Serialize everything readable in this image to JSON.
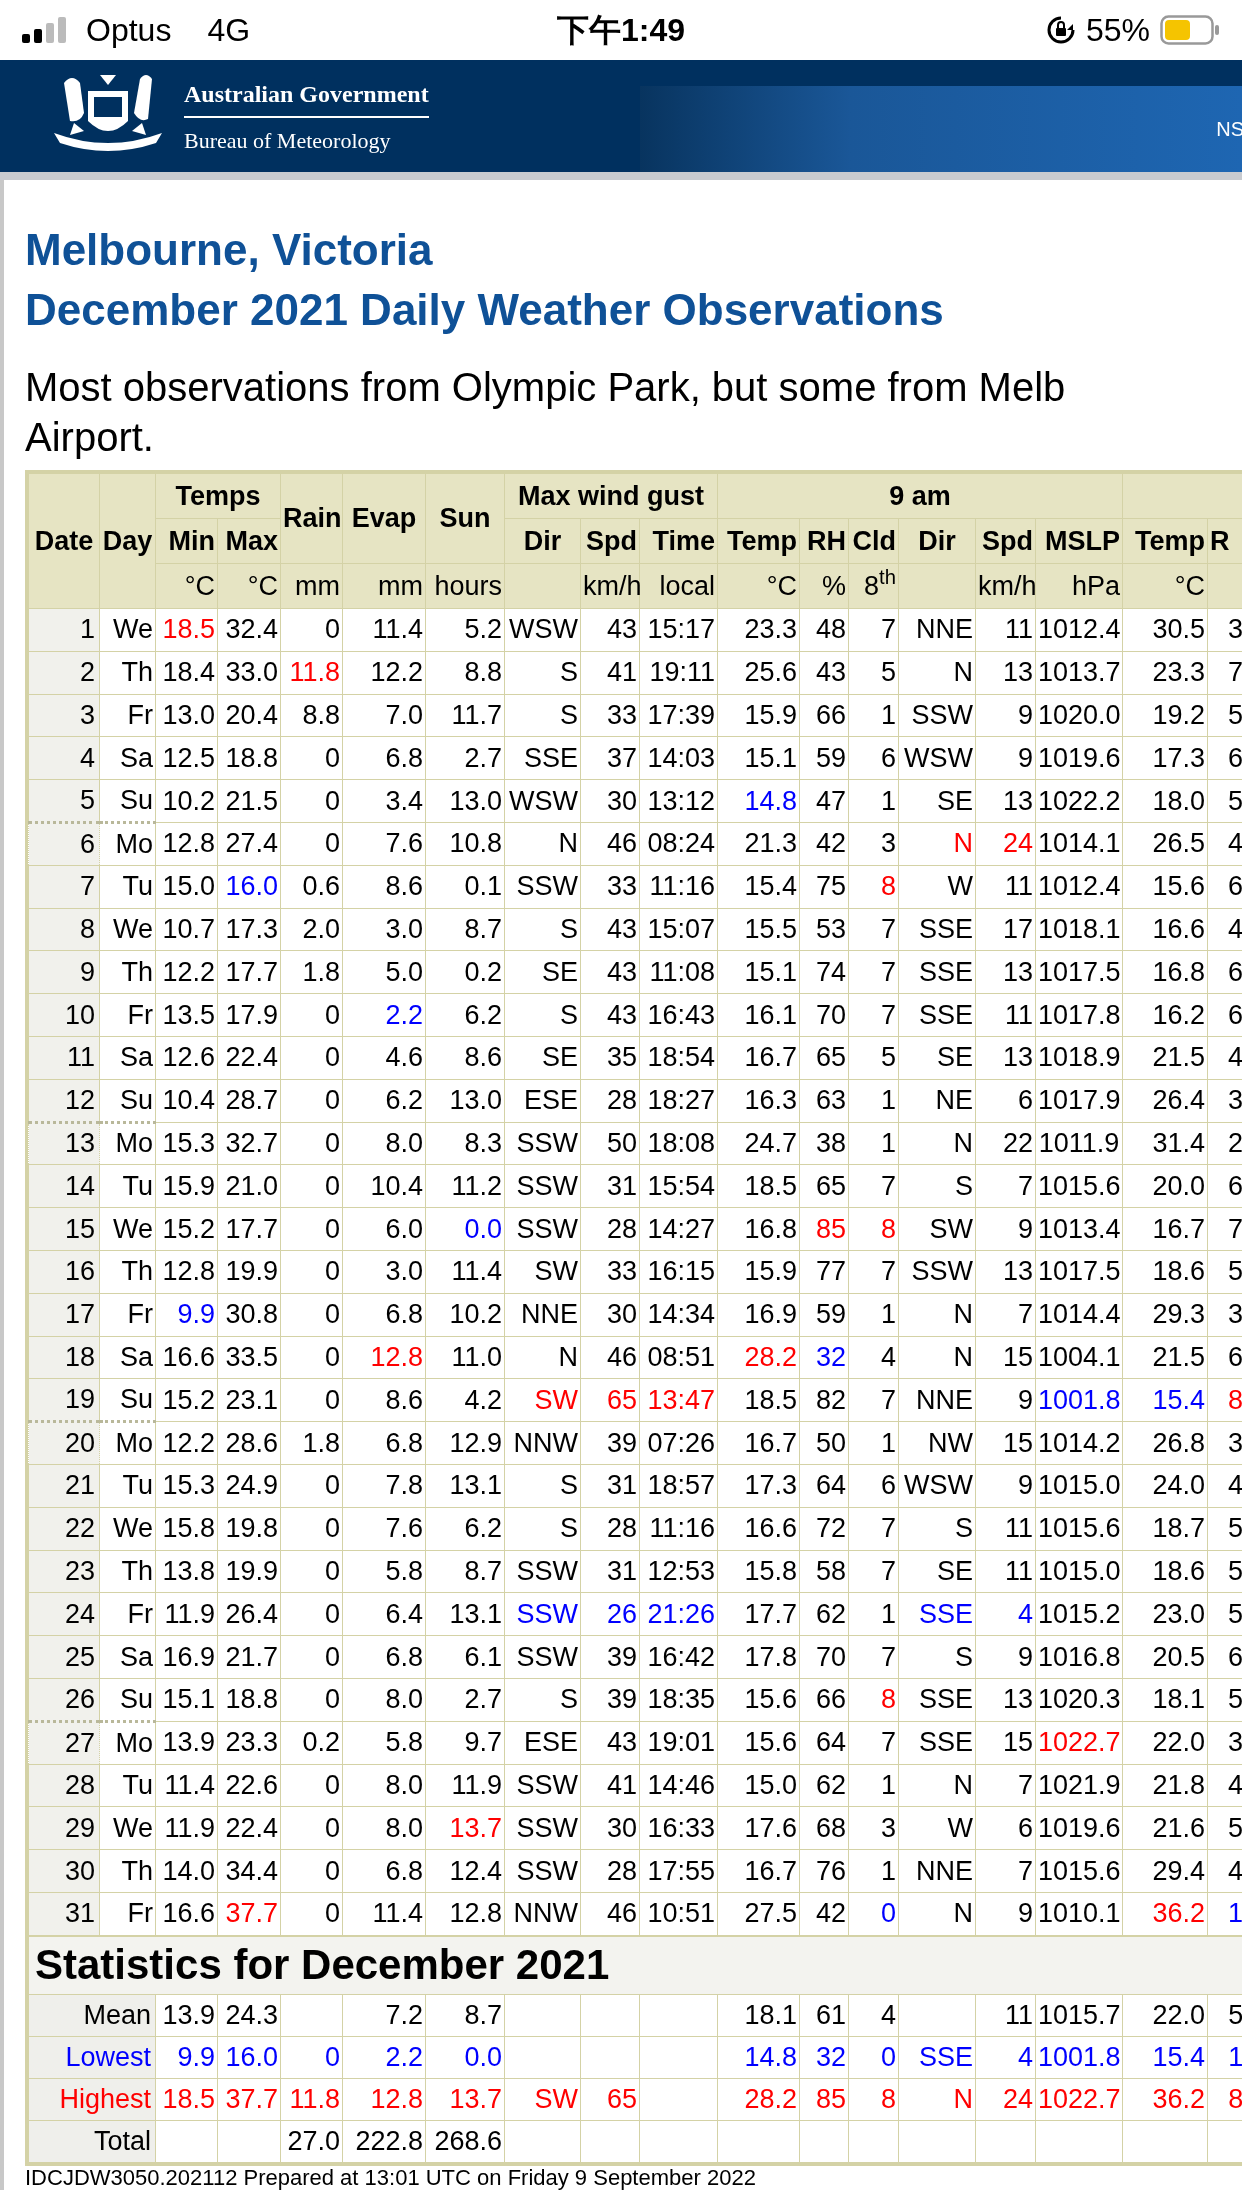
{
  "status_bar": {
    "carrier": "Optus",
    "network": "4G",
    "time": "下午1:49",
    "battery": "55%"
  },
  "banner": {
    "line_1": "Australian Government",
    "line_2": "Bureau of Meteorology",
    "nav_text": "NS"
  },
  "title_lines": [
    "Melbourne, Victoria",
    "December 2021 Daily Weather Observations"
  ],
  "subtitle_lines": [
    "Most observations from Olympic Park, but some from Melb",
    "Airport."
  ],
  "table": {
    "header": {
      "date": "Date",
      "day": "Day",
      "temps": "Temps",
      "rain": "Rain",
      "evap": "Evap",
      "sun": "Sun",
      "gust": "Max wind gust",
      "nine_am": "9 am",
      "columns": [
        "Min",
        "Max",
        "Dir",
        "Spd",
        "Time",
        "Temp",
        "RH",
        "Cld",
        "Dir",
        "Spd",
        "MSLP",
        "Temp",
        "R"
      ],
      "units": [
        "°C",
        "°C",
        "mm",
        "mm",
        "hours",
        "km/h",
        "local",
        "°C",
        "%",
        "8$^{th}$",
        "km/h",
        "hPa",
        "°C"
      ]
    },
    "rows": [
      {
        "week_start": false,
        "cells": [
          "1",
          "We",
          {
            "text": "18.5",
            "color": "#ff0000"
          },
          "32.4",
          "0",
          "11.4",
          "5.2",
          "WSW",
          "43",
          "15:17",
          "23.3",
          "48",
          "7",
          "NNE",
          "11",
          "1012.4",
          "30.5",
          "3"
        ]
      },
      {
        "week_start": false,
        "cells": [
          "2",
          "Th",
          "18.4",
          "33.0",
          {
            "text": "11.8",
            "color": "#ff0000"
          },
          "12.2",
          "8.8",
          "S",
          "41",
          "19:11",
          "25.6",
          "43",
          "5",
          "N",
          "13",
          "1013.7",
          "23.3",
          "7"
        ]
      },
      {
        "week_start": false,
        "cells": [
          "3",
          "Fr",
          "13.0",
          "20.4",
          "8.8",
          "7.0",
          "11.7",
          "S",
          "33",
          "17:39",
          "15.9",
          "66",
          "1",
          "SSW",
          "9",
          "1020.0",
          "19.2",
          "5"
        ]
      },
      {
        "week_start": false,
        "cells": [
          "4",
          "Sa",
          "12.5",
          "18.8",
          "0",
          "6.8",
          "2.7",
          "SSE",
          "37",
          "14:03",
          "15.1",
          "59",
          "6",
          "WSW",
          "9",
          "1019.6",
          "17.3",
          "6"
        ]
      },
      {
        "week_start": false,
        "cells": [
          "5",
          "Su",
          "10.2",
          "21.5",
          "0",
          "3.4",
          "13.0",
          "WSW",
          "30",
          "13:12",
          {
            "text": "14.8",
            "color": "#0000ff"
          },
          "47",
          "1",
          "SE",
          "13",
          "1022.2",
          "18.0",
          "5"
        ]
      },
      {
        "week_start": true,
        "cells": [
          "6",
          "Mo",
          "12.8",
          "27.4",
          "0",
          "7.6",
          "10.8",
          "N",
          "46",
          "08:24",
          "21.3",
          "42",
          "3",
          {
            "text": "N",
            "color": "#ff0000"
          },
          {
            "text": "24",
            "color": "#ff0000"
          },
          "1014.1",
          "26.5",
          "4"
        ]
      },
      {
        "week_start": false,
        "cells": [
          "7",
          "Tu",
          "15.0",
          {
            "text": "16.0",
            "color": "#0000ff"
          },
          "0.6",
          "8.6",
          "0.1",
          "SSW",
          "33",
          "11:16",
          "15.4",
          "75",
          {
            "text": "8",
            "color": "#ff0000"
          },
          "W",
          "11",
          "1012.4",
          "15.6",
          "6"
        ]
      },
      {
        "week_start": false,
        "cells": [
          "8",
          "We",
          "10.7",
          "17.3",
          "2.0",
          "3.0",
          "8.7",
          "S",
          "43",
          "15:07",
          "15.5",
          "53",
          "7",
          "SSE",
          "17",
          "1018.1",
          "16.6",
          "4"
        ]
      },
      {
        "week_start": false,
        "cells": [
          "9",
          "Th",
          "12.2",
          "17.7",
          "1.8",
          "5.0",
          "0.2",
          "SE",
          "43",
          "11:08",
          "15.1",
          "74",
          "7",
          "SSE",
          "13",
          "1017.5",
          "16.8",
          "6"
        ]
      },
      {
        "week_start": false,
        "cells": [
          "10",
          "Fr",
          "13.5",
          "17.9",
          "0",
          {
            "text": "2.2",
            "color": "#0000ff"
          },
          "6.2",
          "S",
          "43",
          "16:43",
          "16.1",
          "70",
          "7",
          "SSE",
          "11",
          "1017.8",
          "16.2",
          "6"
        ]
      },
      {
        "week_start": false,
        "cells": [
          "11",
          "Sa",
          "12.6",
          "22.4",
          "0",
          "4.6",
          "8.6",
          "SE",
          "35",
          "18:54",
          "16.7",
          "65",
          "5",
          "SE",
          "13",
          "1018.9",
          "21.5",
          "4"
        ]
      },
      {
        "week_start": false,
        "cells": [
          "12",
          "Su",
          "10.4",
          "28.7",
          "0",
          "6.2",
          "13.0",
          "ESE",
          "28",
          "18:27",
          "16.3",
          "63",
          "1",
          "NE",
          "6",
          "1017.9",
          "26.4",
          "3"
        ]
      },
      {
        "week_start": true,
        "cells": [
          "13",
          "Mo",
          "15.3",
          "32.7",
          "0",
          "8.0",
          "8.3",
          "SSW",
          "50",
          "18:08",
          "24.7",
          "38",
          "1",
          "N",
          "22",
          "1011.9",
          "31.4",
          "2"
        ]
      },
      {
        "week_start": false,
        "cells": [
          "14",
          "Tu",
          "15.9",
          "21.0",
          "0",
          "10.4",
          "11.2",
          "SSW",
          "31",
          "15:54",
          "18.5",
          "65",
          "7",
          "S",
          "7",
          "1015.6",
          "20.0",
          "6"
        ]
      },
      {
        "week_start": false,
        "cells": [
          "15",
          "We",
          "15.2",
          "17.7",
          "0",
          "6.0",
          {
            "text": "0.0",
            "color": "#0000ff"
          },
          "SSW",
          "28",
          "14:27",
          "16.8",
          {
            "text": "85",
            "color": "#ff0000"
          },
          {
            "text": "8",
            "color": "#ff0000"
          },
          "SW",
          "9",
          "1013.4",
          "16.7",
          "7"
        ]
      },
      {
        "week_start": false,
        "cells": [
          "16",
          "Th",
          "12.8",
          "19.9",
          "0",
          "3.0",
          "11.4",
          "SW",
          "33",
          "16:15",
          "15.9",
          "77",
          "7",
          "SSW",
          "13",
          "1017.5",
          "18.6",
          "5"
        ]
      },
      {
        "week_start": false,
        "cells": [
          "17",
          "Fr",
          {
            "text": "9.9",
            "color": "#0000ff"
          },
          "30.8",
          "0",
          "6.8",
          "10.2",
          "NNE",
          "30",
          "14:34",
          "16.9",
          "59",
          "1",
          "N",
          "7",
          "1014.4",
          "29.3",
          "3"
        ]
      },
      {
        "week_start": false,
        "cells": [
          "18",
          "Sa",
          "16.6",
          "33.5",
          "0",
          {
            "text": "12.8",
            "color": "#ff0000"
          },
          "11.0",
          "N",
          "46",
          "08:51",
          {
            "text": "28.2",
            "color": "#ff0000"
          },
          {
            "text": "32",
            "color": "#0000ff"
          },
          "4",
          "N",
          "15",
          "1004.1",
          "21.5",
          "6"
        ]
      },
      {
        "week_start": false,
        "cells": [
          "19",
          "Su",
          "15.2",
          "23.1",
          "0",
          "8.6",
          "4.2",
          {
            "text": "SW",
            "color": "#ff0000"
          },
          {
            "text": "65",
            "color": "#ff0000"
          },
          {
            "text": "13:47",
            "color": "#ff0000"
          },
          "18.5",
          "82",
          "7",
          "NNE",
          "9",
          {
            "text": "1001.8",
            "color": "#0000ff"
          },
          {
            "text": "15.4",
            "color": "#0000ff"
          },
          {
            "text": "8",
            "color": "#ff0000"
          }
        ]
      },
      {
        "week_start": true,
        "cells": [
          "20",
          "Mo",
          "12.2",
          "28.6",
          "1.8",
          "6.8",
          "12.9",
          "NNW",
          "39",
          "07:26",
          "16.7",
          "50",
          "1",
          "NW",
          "15",
          "1014.2",
          "26.8",
          "3"
        ]
      },
      {
        "week_start": false,
        "cells": [
          "21",
          "Tu",
          "15.3",
          "24.9",
          "0",
          "7.8",
          "13.1",
          "S",
          "31",
          "18:57",
          "17.3",
          "64",
          "6",
          "WSW",
          "9",
          "1015.0",
          "24.0",
          "4"
        ]
      },
      {
        "week_start": false,
        "cells": [
          "22",
          "We",
          "15.8",
          "19.8",
          "0",
          "7.6",
          "6.2",
          "S",
          "28",
          "11:16",
          "16.6",
          "72",
          "7",
          "S",
          "11",
          "1015.6",
          "18.7",
          "5"
        ]
      },
      {
        "week_start": false,
        "cells": [
          "23",
          "Th",
          "13.8",
          "19.9",
          "0",
          "5.8",
          "8.7",
          "SSW",
          "31",
          "12:53",
          "15.8",
          "58",
          "7",
          "SE",
          "11",
          "1015.0",
          "18.6",
          "5"
        ]
      },
      {
        "week_start": false,
        "cells": [
          "24",
          "Fr",
          "11.9",
          "26.4",
          "0",
          "6.4",
          "13.1",
          {
            "text": "SSW",
            "color": "#0000ff"
          },
          {
            "text": "26",
            "color": "#0000ff"
          },
          {
            "text": "21:26",
            "color": "#0000ff"
          },
          "17.7",
          "62",
          "1",
          {
            "text": "SSE",
            "color": "#0000ff"
          },
          {
            "text": "4",
            "color": "#0000ff"
          },
          "1015.2",
          "23.0",
          "5"
        ]
      },
      {
        "week_start": false,
        "cells": [
          "25",
          "Sa",
          "16.9",
          "21.7",
          "0",
          "6.8",
          "6.1",
          "SSW",
          "39",
          "16:42",
          "17.8",
          "70",
          "7",
          "S",
          "9",
          "1016.8",
          "20.5",
          "6"
        ]
      },
      {
        "week_start": false,
        "cells": [
          "26",
          "Su",
          "15.1",
          "18.8",
          "0",
          "8.0",
          "2.7",
          "S",
          "39",
          "18:35",
          "15.6",
          "66",
          {
            "text": "8",
            "color": "#ff0000"
          },
          "SSE",
          "13",
          "1020.3",
          "18.1",
          "5"
        ]
      },
      {
        "week_start": true,
        "cells": [
          "27",
          "Mo",
          "13.9",
          "23.3",
          "0.2",
          "5.8",
          "9.7",
          "ESE",
          "43",
          "19:01",
          "15.6",
          "64",
          "7",
          "SSE",
          "15",
          {
            "text": "1022.7",
            "color": "#ff0000"
          },
          "22.0",
          "3"
        ]
      },
      {
        "week_start": false,
        "cells": [
          "28",
          "Tu",
          "11.4",
          "22.6",
          "0",
          "8.0",
          "11.9",
          "SSW",
          "41",
          "14:46",
          "15.0",
          "62",
          "1",
          "N",
          "7",
          "1021.9",
          "21.8",
          "4"
        ]
      },
      {
        "week_start": false,
        "cells": [
          "29",
          "We",
          "11.9",
          "22.4",
          "0",
          "8.0",
          {
            "text": "13.7",
            "color": "#ff0000"
          },
          "SSW",
          "30",
          "16:33",
          "17.6",
          "68",
          "3",
          "W",
          "6",
          "1019.6",
          "21.6",
          "5"
        ]
      },
      {
        "week_start": false,
        "cells": [
          "30",
          "Th",
          "14.0",
          "34.4",
          "0",
          "6.8",
          "12.4",
          "SSW",
          "28",
          "17:55",
          "16.7",
          "76",
          "1",
          "NNE",
          "7",
          "1015.6",
          "29.4",
          "4"
        ]
      },
      {
        "week_start": false,
        "cells": [
          "31",
          "Fr",
          "16.6",
          {
            "text": "37.7",
            "color": "#ff0000"
          },
          "0",
          "11.4",
          "12.8",
          "NNW",
          "46",
          "10:51",
          "27.5",
          "42",
          {
            "text": "0",
            "color": "#0000ff"
          },
          "N",
          "9",
          "1010.1",
          {
            "text": "36.2",
            "color": "#ff0000"
          },
          {
            "text": "1",
            "color": "#0000ff"
          }
        ]
      }
    ]
  },
  "statistics": {
    "title": "Statistics for December 2021",
    "rows": [
      {
        "label": "Mean",
        "color": "#000000",
        "cells": [
          "13.9",
          "24.3",
          null,
          "7.2",
          "8.7",
          null,
          null,
          null,
          "18.1",
          "61",
          "4",
          null,
          "11",
          "1015.7",
          "22.0",
          "5"
        ]
      },
      {
        "label": "Lowest",
        "color": "#0000ff",
        "cells": [
          "9.9",
          "16.0",
          "0",
          "2.2",
          "0.0",
          null,
          null,
          null,
          "14.8",
          "32",
          "0",
          "SSE",
          "4",
          "1001.8",
          "15.4",
          "1"
        ]
      },
      {
        "label": "Highest",
        "color": "#ff0000",
        "cells": [
          "18.5",
          "37.7",
          "11.8",
          "12.8",
          "13.7",
          "SW",
          "65",
          null,
          "28.2",
          "85",
          "8",
          "N",
          "24",
          "1022.7",
          "36.2",
          "8"
        ]
      },
      {
        "label": "Total",
        "color": "#000000",
        "cells": [
          null,
          null,
          "27.0",
          "222.8",
          "268.6",
          null,
          null,
          null,
          null,
          null,
          null,
          null,
          null,
          null,
          null,
          null
        ]
      }
    ]
  },
  "footer": "IDCJDW3050.202112   Prepared at 13:01 UTC on Friday 9 September 2022"
}
